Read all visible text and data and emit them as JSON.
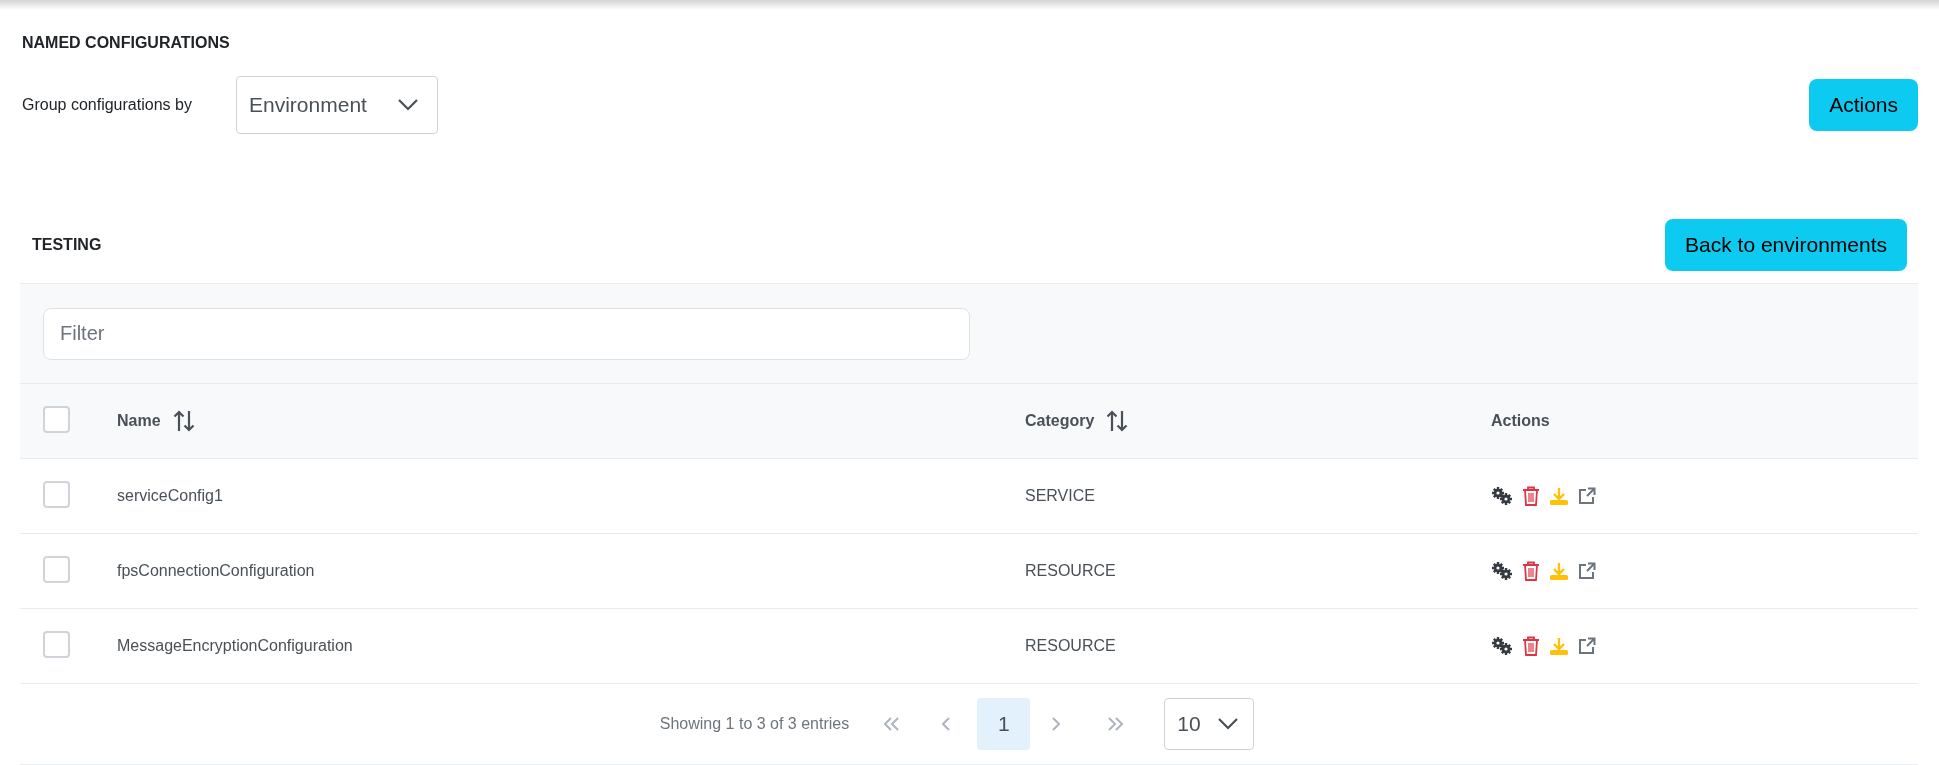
{
  "title": "NAMED CONFIGURATIONS",
  "group_by": {
    "label": "Group configurations by",
    "value": "Environment"
  },
  "actions_button": "Actions",
  "section": {
    "title": "TESTING",
    "back_button": "Back to environments"
  },
  "filter": {
    "placeholder": "Filter"
  },
  "table": {
    "select_all_checked": false,
    "columns": [
      {
        "label": "Name",
        "sortable": true
      },
      {
        "label": "Category",
        "sortable": true
      },
      {
        "label": "Actions",
        "sortable": false
      }
    ],
    "rows": [
      {
        "name": "serviceConfig1",
        "category": "SERVICE",
        "checked": false
      },
      {
        "name": "fpsConnectionConfiguration",
        "category": "RESOURCE",
        "checked": false
      },
      {
        "name": "MessageEncryptionConfiguration",
        "category": "RESOURCE",
        "checked": false
      }
    ]
  },
  "pagination": {
    "summary": "Showing 1 to 3 of 3 entries",
    "pages": [
      {
        "label": "1",
        "selected": true
      }
    ],
    "page_size": "10"
  }
}
